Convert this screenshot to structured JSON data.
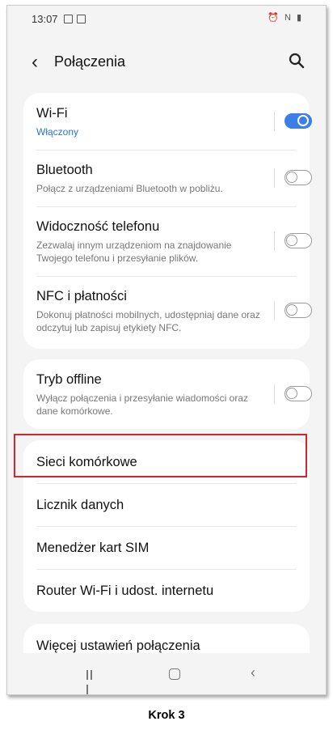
{
  "status": {
    "time": "13:07",
    "right_icons": "⏰ N ▮"
  },
  "header": {
    "title": "Połączenia"
  },
  "card1": {
    "items": [
      {
        "label": "Wi-Fi",
        "sub": "Włączony"
      },
      {
        "label": "Bluetooth",
        "sub": "Połącz z urządzeniami Bluetooth w pobliżu."
      },
      {
        "label": "Widoczność telefonu",
        "sub": "Zezwalaj innym urządzeniom na znajdowanie Twojego telefonu i przesyłanie plików."
      },
      {
        "label": "NFC i płatności",
        "sub": "Dokonuj płatności mobilnych, udostępniaj dane oraz odczytuj lub zapisuj etykiety NFC."
      }
    ]
  },
  "card2": {
    "label": "Tryb offline",
    "sub": "Wyłącz połączenia i przesyłanie wiadomości oraz dane komórkowe."
  },
  "card3": {
    "items": [
      {
        "label": "Sieci komórkowe"
      },
      {
        "label": "Licznik danych"
      },
      {
        "label": "Menedżer kart SIM"
      },
      {
        "label": "Router Wi-Fi i udost. internetu"
      }
    ]
  },
  "card4": {
    "label": "Więcej ustawień połączenia"
  },
  "caption": "Krok 3",
  "colors": {
    "accent": "#3b7ee8",
    "highlight": "#d2262d"
  }
}
